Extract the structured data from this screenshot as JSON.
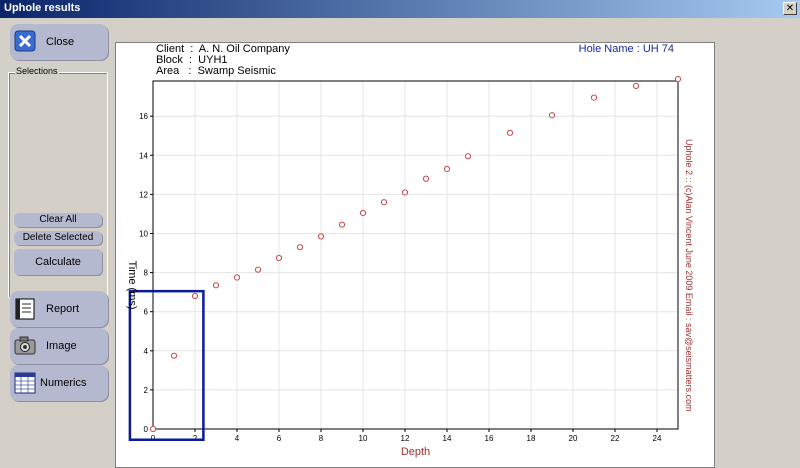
{
  "window": {
    "title": "Uphole results",
    "close_glyph": "✕"
  },
  "sidebar": {
    "close_label": "Close",
    "selections_label": "Selections",
    "clear_all_label": "Clear All",
    "delete_selected_label": "Delete Selected",
    "calculate_label": "Calculate",
    "report_label": "Report",
    "image_label": "Image",
    "numerics_label": "Numerics"
  },
  "plot_header": {
    "client": "Client  :  A. N. Oil Company",
    "block": "Block  :  UYH1",
    "area": "Area   :  Swamp Seismic",
    "hole": "Hole Name : UH 74"
  },
  "side_text": "Uphole 2 :: (c)Alan Vincent June 2009 Email : sav@seismatters.com",
  "colors": {
    "points": "#c8474a",
    "selection": "#0a1a9a",
    "axis_label": "#a03030"
  },
  "chart_data": {
    "type": "scatter",
    "xlabel": "Depth",
    "ylabel": "Time (ms)",
    "xlim": [
      0,
      25
    ],
    "ylim": [
      0,
      17.8
    ],
    "x_ticks": [
      "0",
      "2",
      "4",
      "6",
      "8",
      "10",
      "12",
      "14",
      "16",
      "18",
      "20",
      "22",
      "24"
    ],
    "y_ticks": [
      "0",
      "2",
      "4",
      "6",
      "8",
      "10",
      "12",
      "14",
      "16"
    ],
    "grid": true,
    "points": [
      {
        "x": 0,
        "y": 0
      },
      {
        "x": 1,
        "y": 3.75
      },
      {
        "x": 2,
        "y": 6.8
      },
      {
        "x": 3,
        "y": 7.35
      },
      {
        "x": 4,
        "y": 7.75
      },
      {
        "x": 5,
        "y": 8.15
      },
      {
        "x": 6,
        "y": 8.75
      },
      {
        "x": 7,
        "y": 9.3
      },
      {
        "x": 8,
        "y": 9.85
      },
      {
        "x": 9,
        "y": 10.45
      },
      {
        "x": 10,
        "y": 11.05
      },
      {
        "x": 11,
        "y": 11.6
      },
      {
        "x": 12,
        "y": 12.1
      },
      {
        "x": 13,
        "y": 12.8
      },
      {
        "x": 14,
        "y": 13.3
      },
      {
        "x": 15,
        "y": 13.95
      },
      {
        "x": 17,
        "y": 15.15
      },
      {
        "x": 19,
        "y": 16.05
      },
      {
        "x": 21,
        "y": 16.95
      },
      {
        "x": 23,
        "y": 17.55
      },
      {
        "x": 25,
        "y": 17.9
      }
    ],
    "selection_box": {
      "x0": -1.1,
      "x1": 2.4,
      "y0": -0.55,
      "y1": 7.05
    }
  }
}
